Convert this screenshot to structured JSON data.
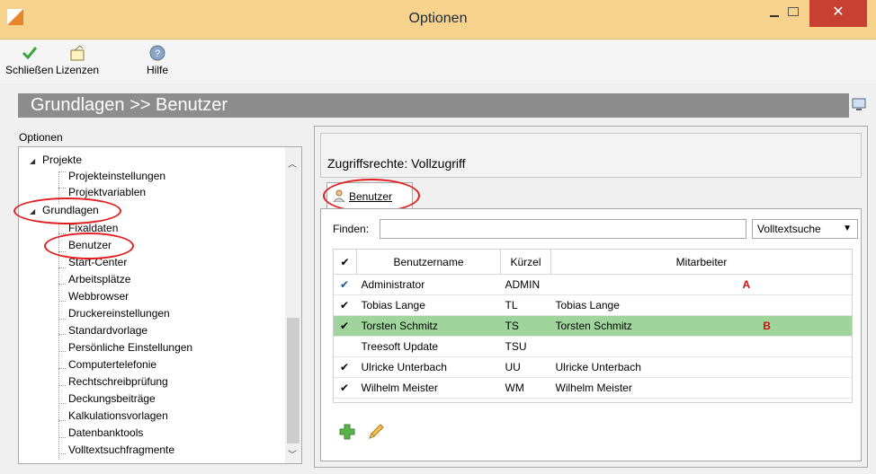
{
  "window": {
    "title": "Optionen"
  },
  "toolbar": {
    "close_label": "Schließen",
    "licenses_label": "Lizenzen",
    "help_label": "Hilfe"
  },
  "header": {
    "breadcrumb": "Grundlagen >> Benutzer"
  },
  "left": {
    "label": "Optionen",
    "tree": [
      "Projekte",
      "Projekteinstellungen",
      "Projektvariablen",
      "Grundlagen",
      "Fixaldaten",
      "Benutzer",
      "Start-Center",
      "Arbeitsplätze",
      "Webbrowser",
      "Druckereinstellungen",
      "Standardvorlage",
      "Persönliche Einstellungen",
      "Computertelefonie",
      "Rechtschreibprüfung",
      "Deckungsbeiträge",
      "Kalkulationsvorlagen",
      "Datenbanktools",
      "Volltextsuchfragmente"
    ]
  },
  "right": {
    "access": "Zugriffsrechte: Vollzugriff",
    "tab_label": "Benutzer",
    "find_label": "Finden:",
    "find_value": "",
    "search_mode": "Volltextsuche",
    "columns": [
      "Benutzername",
      "Kürzel",
      "Mitarbeiter"
    ],
    "rows": [
      {
        "check": "✔",
        "name": "Administrator",
        "short": "ADMIN",
        "employee": "",
        "marker": "A"
      },
      {
        "check": "✔",
        "name": "Tobias Lange",
        "short": "TL",
        "employee": "Tobias Lange",
        "marker": ""
      },
      {
        "check": "✔",
        "name": "Torsten Schmitz",
        "short": "TS",
        "employee": "Torsten Schmitz",
        "marker": "B"
      },
      {
        "check": "",
        "name": "Treesoft Update",
        "short": "TSU",
        "employee": "",
        "marker": ""
      },
      {
        "check": "✔",
        "name": "Ulricke Unterbach",
        "short": "UU",
        "employee": "Ulricke Unterbach",
        "marker": ""
      },
      {
        "check": "✔",
        "name": "Wilhelm Meister",
        "short": "WM",
        "employee": "Wilhelm Meister",
        "marker": ""
      }
    ]
  },
  "colors": {
    "titlebar": "#f7d28c",
    "close_button": "#c84031",
    "header_bar": "#8d8d8d",
    "selected_row": "#9fd59c",
    "annotation": "#e02020"
  }
}
